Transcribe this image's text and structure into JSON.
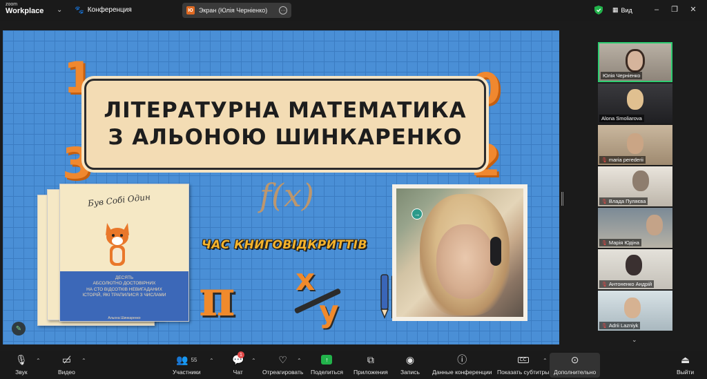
{
  "app": {
    "brand_small": "zoom",
    "brand_big": "Workplace",
    "conference_label": "Конференция",
    "share_avatar": "Ю",
    "share_title": "Экран (Юлія Черніенко)",
    "view_label": "Вид"
  },
  "slide": {
    "digits": [
      "1",
      "0",
      "3",
      "2"
    ],
    "title_line1": "ЛІТЕРАТУРНА МАТЕМАТИКА",
    "title_line2": "З АЛЬОНОЮ ШИНКАРЕНКО",
    "fx": "f(x)",
    "time_label": "ЧАС КНИГОВІДКРИТТІВ",
    "pi": "π",
    "x": "x",
    "y": "y",
    "book": {
      "title": "Був Собі Один",
      "subtitle_lines": [
        "Десять",
        "абсолютно достовірних",
        "на сто відсотків невигаданих",
        "історій, які трапилися з числами"
      ],
      "author": "Альона Шинкаренко"
    }
  },
  "participants": [
    {
      "name": "Юлія Черніенко",
      "muted": false,
      "active": true
    },
    {
      "name": "Alona Smoliarova",
      "muted": false,
      "active": false
    },
    {
      "name": "maria perederii",
      "muted": true,
      "active": false
    },
    {
      "name": "Влада Пуляєва",
      "muted": true,
      "active": false
    },
    {
      "name": "Марія Юдіна",
      "muted": true,
      "active": false
    },
    {
      "name": "Антоненко Андрій",
      "muted": true,
      "active": false
    },
    {
      "name": "Adrii Lazniyk",
      "muted": true,
      "active": false
    }
  ],
  "toolbar": {
    "audio": "Звук",
    "video": "Видео",
    "participants": "Участники",
    "participants_count": "55",
    "chat": "Чат",
    "chat_badge": "1",
    "react": "Отреагировать",
    "share": "Поделиться",
    "apps": "Приложения",
    "record": "Запись",
    "info": "Данные конференции",
    "captions": "Показать субтитры",
    "more": "Дополнительно",
    "leave": "Выйти"
  },
  "colors": {
    "slide_bg": "#4a8fd6",
    "accent_orange": "#f08a2c",
    "title_box": "#f3dcb4",
    "active_speaker": "#2ecc71",
    "muted_red": "#e34848"
  }
}
